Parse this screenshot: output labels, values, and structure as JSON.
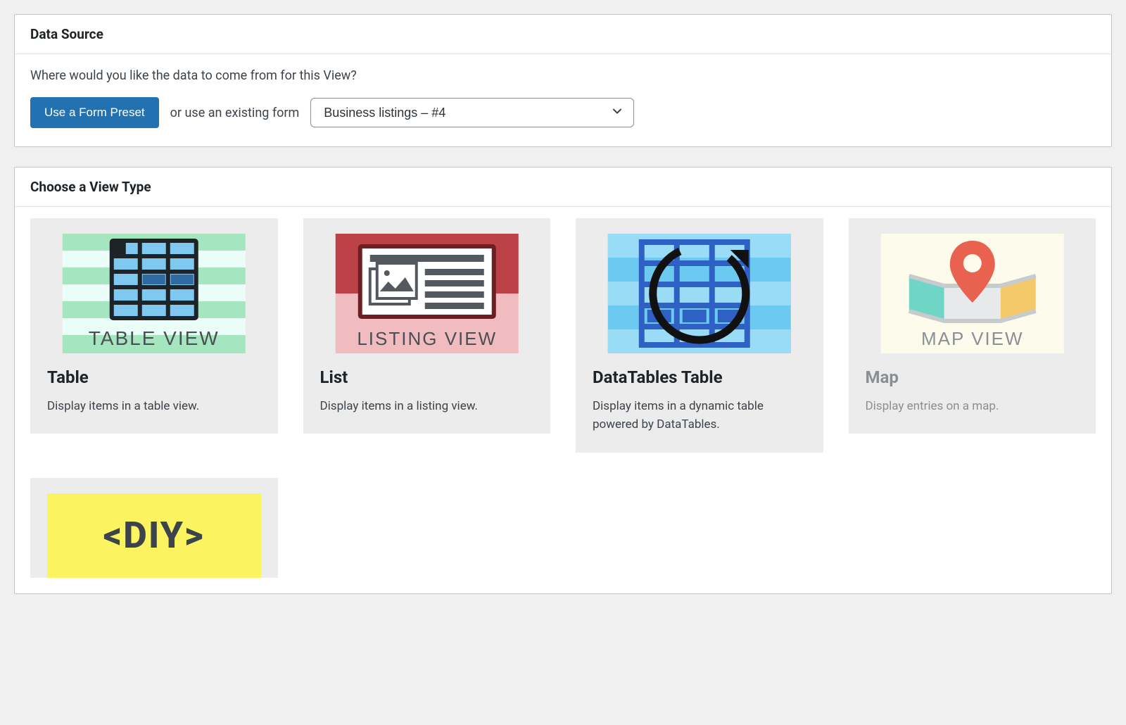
{
  "dataSource": {
    "title": "Data Source",
    "prompt": "Where would you like the data to come from for this View?",
    "presetButton": "Use a Form Preset",
    "orLabel": "or use an existing form",
    "selectedForm": "Business listings – #4"
  },
  "viewType": {
    "title": "Choose a View Type",
    "cards": [
      {
        "title": "Table",
        "desc": "Display items in a table view.",
        "thumbLabel": "TABLE VIEW"
      },
      {
        "title": "List",
        "desc": "Display items in a listing view.",
        "thumbLabel": "LISTING VIEW"
      },
      {
        "title": "DataTables Table",
        "desc": "Display items in a dynamic table powered by DataTables.",
        "thumbLabel": ""
      },
      {
        "title": "Map",
        "desc": "Display entries on a map.",
        "thumbLabel": "MAP VIEW"
      },
      {
        "title": "",
        "desc": "",
        "thumbLabel": "<DIY>"
      }
    ]
  }
}
